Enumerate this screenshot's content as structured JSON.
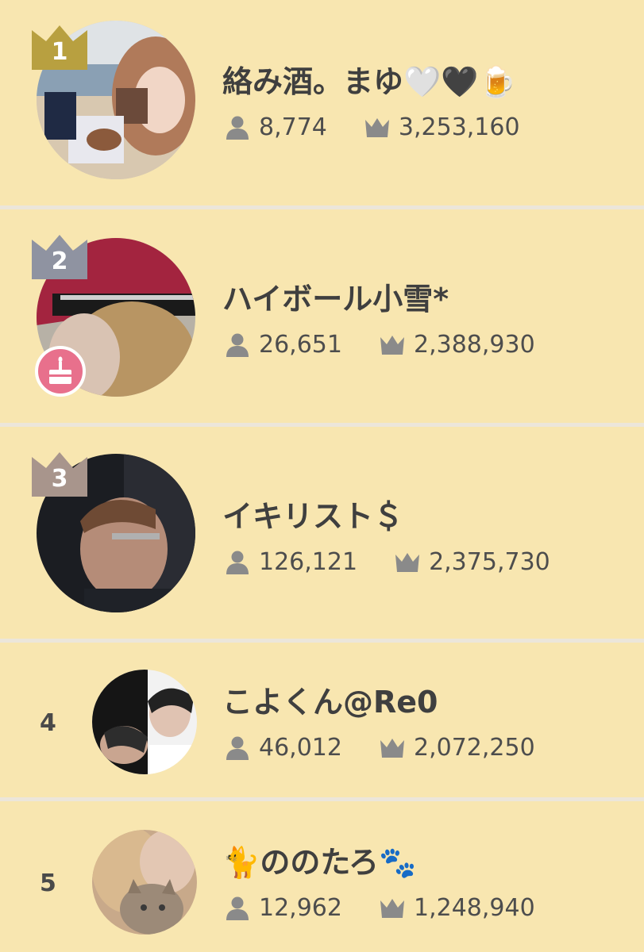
{
  "theme": {
    "background": "#f8e6b0",
    "divider": "#ece6da",
    "gold": "#b8a040",
    "silver": "#8f93a1",
    "bronze": "#a8958c",
    "icon_gray": "#8a8a8a",
    "badge_pink": "#e8708c"
  },
  "rows": [
    {
      "rank": "1",
      "name": "絡み酒。まゆ🤍🖤🍺",
      "followers": "8,774",
      "score": "3,253,160",
      "crown": "gold"
    },
    {
      "rank": "2",
      "name": "ハイボール小雪*",
      "followers": "26,651",
      "score": "2,388,930",
      "crown": "silver",
      "badge_icon": "birthday-cake-icon"
    },
    {
      "rank": "3",
      "name": "イキリスト＄",
      "followers": "126,121",
      "score": "2,375,730",
      "crown": "bronze"
    },
    {
      "rank": "4",
      "name": "こよくん@Re0",
      "followers": "46,012",
      "score": "2,072,250"
    },
    {
      "rank": "5",
      "name": "🐈ののたろ🐾",
      "followers": "12,962",
      "score": "1,248,940"
    }
  ],
  "icons": {
    "followers": "person-icon",
    "score": "crown-icon"
  }
}
